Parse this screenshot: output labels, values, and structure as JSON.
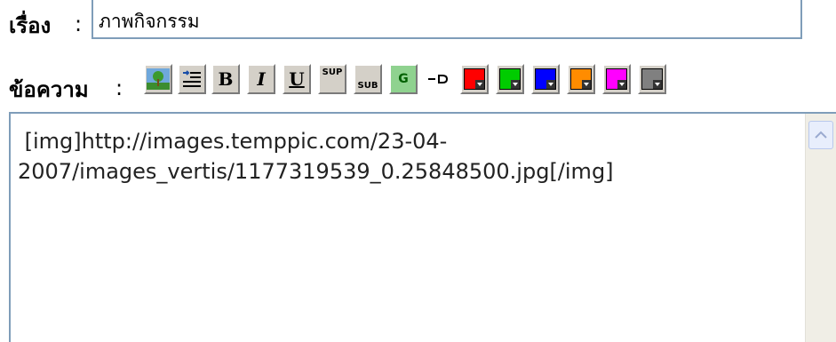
{
  "subject": {
    "label": "เรื่อง",
    "colon": ":",
    "value": "ภาพกิจกรรม"
  },
  "message": {
    "label": "ข้อความ",
    "colon": ":",
    "content": " [img]http://images.temppic.com/23-04-\n2007/images_vertis/1177319539_0.25848500.jpg[/img]"
  },
  "toolbar": {
    "bold_label": "B",
    "italic_label": "I",
    "underline_label": "U",
    "sup_label": "SUP",
    "sub_label": "SUB",
    "glow_label": "G",
    "colors": [
      "#ff0000",
      "#00cc00",
      "#0000ff",
      "#ff8c00",
      "#ff00ff",
      "#808080"
    ]
  },
  "icons": [
    "image-icon",
    "indent-icon",
    "bold-icon",
    "italic-icon",
    "underline-icon",
    "superscript-icon",
    "subscript-icon",
    "glow-icon",
    "shadow-icon",
    "color-picker-icon"
  ]
}
